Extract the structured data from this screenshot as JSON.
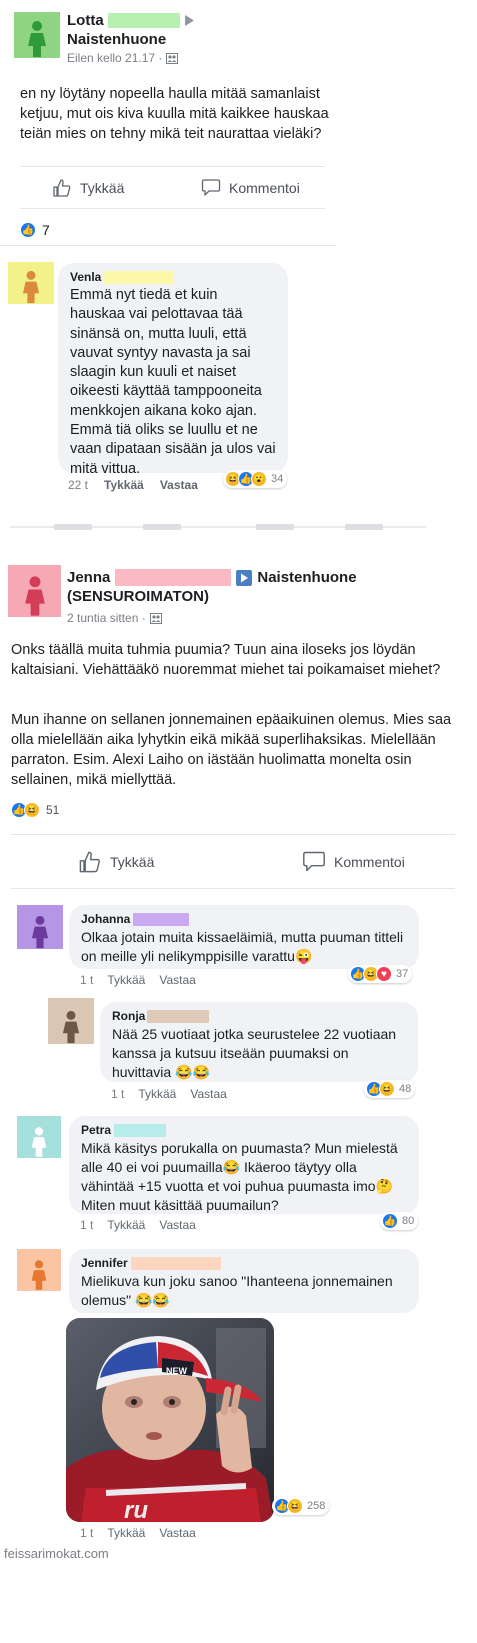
{
  "post1": {
    "author": "Lotta",
    "group": "Naistenhuone",
    "time": "Eilen kello 21.17 ·",
    "text": "en ny löytäny nopeella haulla mitää samanlaist ketjuu, mut ois kiva kuulla mitä kaikkee hauskaa teiän mies on tehny mikä teit naurattaa vieläki?",
    "like_label": "Tykkää",
    "comment_label": "Kommentoi",
    "likes": "7",
    "colors": {
      "avatar_bg": "#8ed483",
      "avatar_fig": "#2e9a3a",
      "name_blur": "#b8f0b2"
    }
  },
  "comment1": {
    "author": "Venla",
    "text": "Emmä nyt tiedä et kuin hauskaa vai pelottavaa tää sinänsä on, mutta luuli, että vauvat syntyy navasta ja sai slaagin kun kuuli et naiset oikeesti käyttää tamppooneita menkkojen aikana koko ajan. Emmä tiä oliks se luullu et ne vaan dipataan sisään ja ulos vai mitä vittua.",
    "time": "22 t",
    "like": "Tykkää",
    "reply": "Vastaa",
    "reactions": "34",
    "colors": {
      "avatar_bg": "#f3f18a",
      "avatar_fig": "#d98a3d",
      "name_blur": "#fbf8a8"
    }
  },
  "post2": {
    "author": "Jenna",
    "group": "Naistenhuone",
    "group_line2": "(SENSUROIMATON)",
    "time": "2 tuntia sitten ·",
    "text1": "Onks täällä muita tuhmia puumia? Tuun aina iloseks jos löydän kaltaisiani. Viehättääkö nuoremmat miehet tai poikamaiset miehet?",
    "text2": "Mun ihanne on sellanen jonnemainen epäaikuinen olemus. Mies saa olla mielellään aika lyhytkin eikä mikää superlihaksikas. Mielellään parraton. Esim. Alexi Laiho on iästään huolimatta monelta osin sellainen, mikä miellyttää.",
    "reactions": "51",
    "like_label": "Tykkää",
    "comment_label": "Kommentoi",
    "colors": {
      "avatar_bg": "#f6a9b5",
      "avatar_fig": "#d33d57",
      "name_blur": "#fbb9c4"
    }
  },
  "comments": [
    {
      "author": "Johanna",
      "text": "Olkaa jotain muita kissaeläimiä, mutta puuman titteli on meille yli nelikymppisille varattu😜",
      "time": "1 t",
      "like": "Tykkää",
      "reply": "Vastaa",
      "reactions": "37",
      "colors": {
        "avatar_bg": "#b596e6",
        "avatar_fig": "#6a3a9c",
        "name_blur": "#c9aaf0"
      }
    },
    {
      "author": "Ronja",
      "text": "Nää 25 vuotiaat jotka seurustelee 22 vuotiaan kanssa ja kutsuu itseään puumaksi on huvittavia 😂😂",
      "time": "1 t",
      "like": "Tykkää",
      "reply": "Vastaa",
      "reactions": "48",
      "colors": {
        "avatar_bg": "#d9c6b3",
        "avatar_fig": "#6e5646",
        "name_blur": "#dfcab8"
      }
    },
    {
      "author": "Petra",
      "text": "Mikä käsitys porukalla on puumasta? Mun mielestä alle 40 ei voi puumailla😂 Ikäeroo täytyy olla vähintää +15 vuotta et voi puhua puumasta imo🤔 Miten muut käsittää puumailun?",
      "time": "1 t",
      "like": "Tykkää",
      "reply": "Vastaa",
      "reactions": "80",
      "colors": {
        "avatar_bg": "#a6e0dd",
        "avatar_fig": "#ffffff",
        "name_blur": "#b6ecea"
      }
    },
    {
      "author": "Jennifer",
      "text": "Mielikuva kun joku sanoo \"Ihanteena jonnemainen olemus\" 😂😂",
      "time": "1 t",
      "like": "Tykkää",
      "reply": "Vastaa",
      "reactions": "258",
      "colors": {
        "avatar_bg": "#fbc4a3",
        "avatar_fig": "#e6772f",
        "name_blur": "#fcd6bf"
      }
    }
  ],
  "image": {
    "cap_text": "NEW",
    "shirt_text": "ru"
  },
  "watermark": "feissarimokat.com",
  "icons": {
    "arrow": "play-arrow-icon",
    "audience": "group-audience-icon",
    "like": "thumbs-up-icon",
    "comment": "speech-bubble-icon"
  },
  "colors": {
    "fb_blue": "#1877f2",
    "haha_yellow": "#f7b928",
    "love_red": "#f33e58",
    "meta_gray": "#7b7f85",
    "bubble_gray": "#f0f2f5"
  }
}
